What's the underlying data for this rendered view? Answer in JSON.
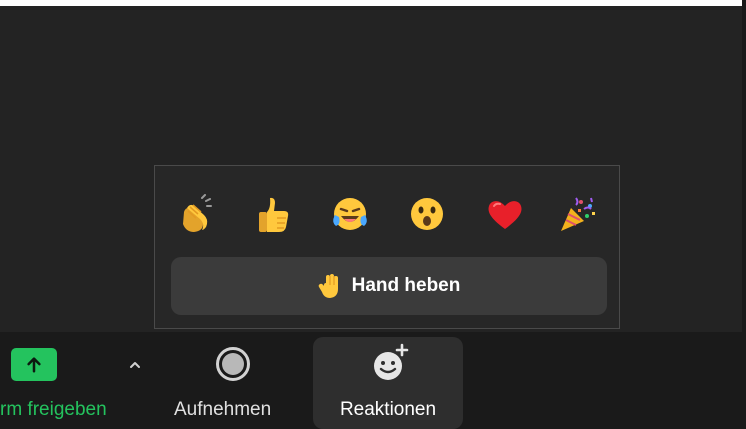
{
  "popover": {
    "emojis": [
      {
        "name": "clapping-hands",
        "glyph": "👏"
      },
      {
        "name": "thumbs-up",
        "glyph": "👍"
      },
      {
        "name": "tears-of-joy",
        "glyph": "😂"
      },
      {
        "name": "open-mouth",
        "glyph": "😮"
      },
      {
        "name": "red-heart",
        "glyph": "❤️"
      },
      {
        "name": "party-popper",
        "glyph": "🎉"
      }
    ],
    "raise_hand_label": "Hand heben"
  },
  "toolbar": {
    "share_label": "rm freigeben",
    "record_label": "Aufnehmen",
    "reactions_label": "Reaktionen"
  },
  "colors": {
    "background": "#232323",
    "toolbar": "#1a1a1a",
    "share_green": "#24c35e",
    "button_bg": "#3b3b3b"
  }
}
